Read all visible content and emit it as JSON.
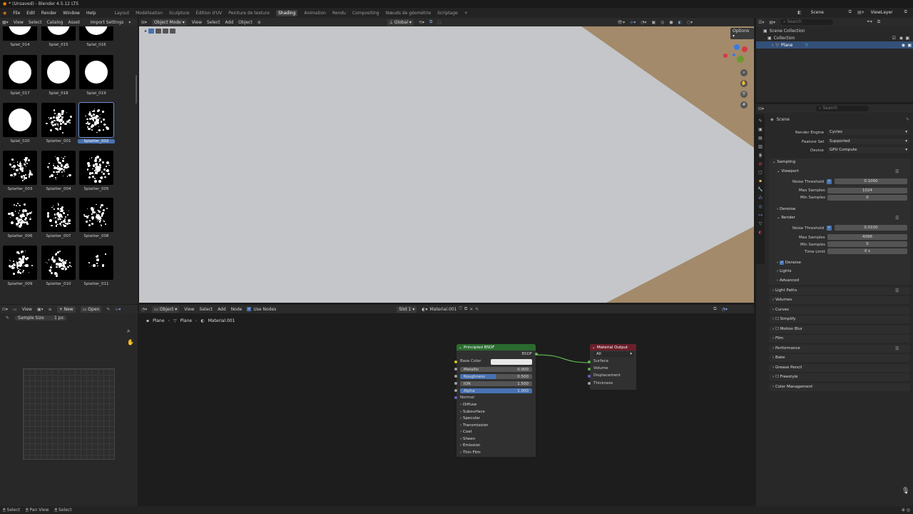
{
  "title": "* (Unsaved) - Blender 4.5.12 LTS",
  "menu": [
    "File",
    "Edit",
    "Render",
    "Window",
    "Help"
  ],
  "workspaces": [
    "Layout",
    "Modélisation",
    "Sculpture",
    "Édition d'UV",
    "Peinture de texture",
    "Shading",
    "Animation",
    "Rendu",
    "Compositing",
    "Nœuds de géométrie",
    "Scriptage"
  ],
  "active_workspace": "Shading",
  "scene_name": "Scene",
  "view_layer": "ViewLayer",
  "browser": {
    "menu": [
      "View",
      "Select",
      "Catalog",
      "Asset"
    ],
    "import_settings": "Import Settings",
    "items": [
      "Splat_014",
      "Splat_015",
      "Splat_016",
      "Splat_017",
      "Splat_018",
      "Splat_019",
      "Splat_020",
      "Splatter_001",
      "Splatter_002",
      "Splatter_003",
      "Splatter_004",
      "Splatter_005",
      "Splatter_006",
      "Splatter_007",
      "Splatter_008",
      "Splatter_009",
      "Splatter_010",
      "Splatter_011"
    ],
    "selected": "Splatter_002"
  },
  "viewport": {
    "mode": "Object Mode",
    "menu": [
      "View",
      "Select",
      "Add",
      "Object"
    ],
    "orientation": "Global",
    "options": "Options"
  },
  "image_editor": {
    "menu": [
      "View"
    ],
    "new": "New",
    "open": "Open",
    "sample_size_label": "Sample Size",
    "sample_size_value": "1 px"
  },
  "node_editor": {
    "mode": "Object",
    "menu": [
      "View",
      "Select",
      "Add",
      "Node"
    ],
    "use_nodes": "Use Nodes",
    "slot": "Slot 1",
    "material": "Material.001",
    "breadcrumb": [
      "Plane",
      "Plane",
      "Material.001"
    ],
    "bsdf": {
      "title": "Principled BSDF",
      "output": "BSDF",
      "base_color": "Base Color",
      "fields": [
        {
          "label": "Metallic",
          "value": "0.000",
          "fill": 0
        },
        {
          "label": "Roughness",
          "value": "0.500",
          "fill": 0.5
        },
        {
          "label": "IOR",
          "value": "1.500",
          "fill": 0
        },
        {
          "label": "Alpha",
          "value": "1.000",
          "fill": 1
        }
      ],
      "normal": "Normal",
      "panels": [
        "Diffuse",
        "Subsurface",
        "Specular",
        "Transmission",
        "Coat",
        "Sheen",
        "Emission",
        "Thin Film"
      ]
    },
    "output_node": {
      "title": "Material Output",
      "target": "All",
      "sockets": [
        "Surface",
        "Volume",
        "Displacement",
        "Thickness"
      ]
    }
  },
  "outliner": {
    "search_placeholder": "Search",
    "root": "Scene Collection",
    "collection": "Collection",
    "object": "Plane"
  },
  "properties": {
    "search_placeholder": "Search",
    "context": "Scene",
    "render_engine_label": "Render Engine",
    "render_engine": "Cycles",
    "feature_set_label": "Feature Set",
    "feature_set": "Supported",
    "device_label": "Device",
    "device": "GPU Compute",
    "sampling": "Sampling",
    "viewport": "Viewport",
    "vp_noise_label": "Noise Threshold",
    "vp_noise": "0.1000",
    "vp_max_label": "Max Samples",
    "vp_max": "1024",
    "vp_min_label": "Min Samples",
    "vp_min": "0",
    "denoise": "Denoise",
    "render": "Render",
    "r_noise_label": "Noise Threshold",
    "r_noise": "0.0100",
    "r_max_label": "Max Samples",
    "r_max": "4096",
    "r_min_label": "Min Samples",
    "r_min": "0",
    "time_limit_label": "Time Limit",
    "time_limit": "0 s",
    "r_denoise": "Denoise",
    "lights": "Lights",
    "advanced": "Advanced",
    "sections": [
      "Light Paths",
      "Volumes",
      "Curves",
      "Simplify",
      "Motion Blur",
      "Film",
      "Performance",
      "Bake",
      "Grease Pencil",
      "Freestyle",
      "Color Management"
    ]
  },
  "status": [
    "Select",
    "Pan View",
    "Select"
  ],
  "colors": {
    "accent": "#4772b3",
    "bsdf_header": "#2b6b2f",
    "output_header": "#6b1f2a",
    "green_link": "#5fb34f"
  }
}
